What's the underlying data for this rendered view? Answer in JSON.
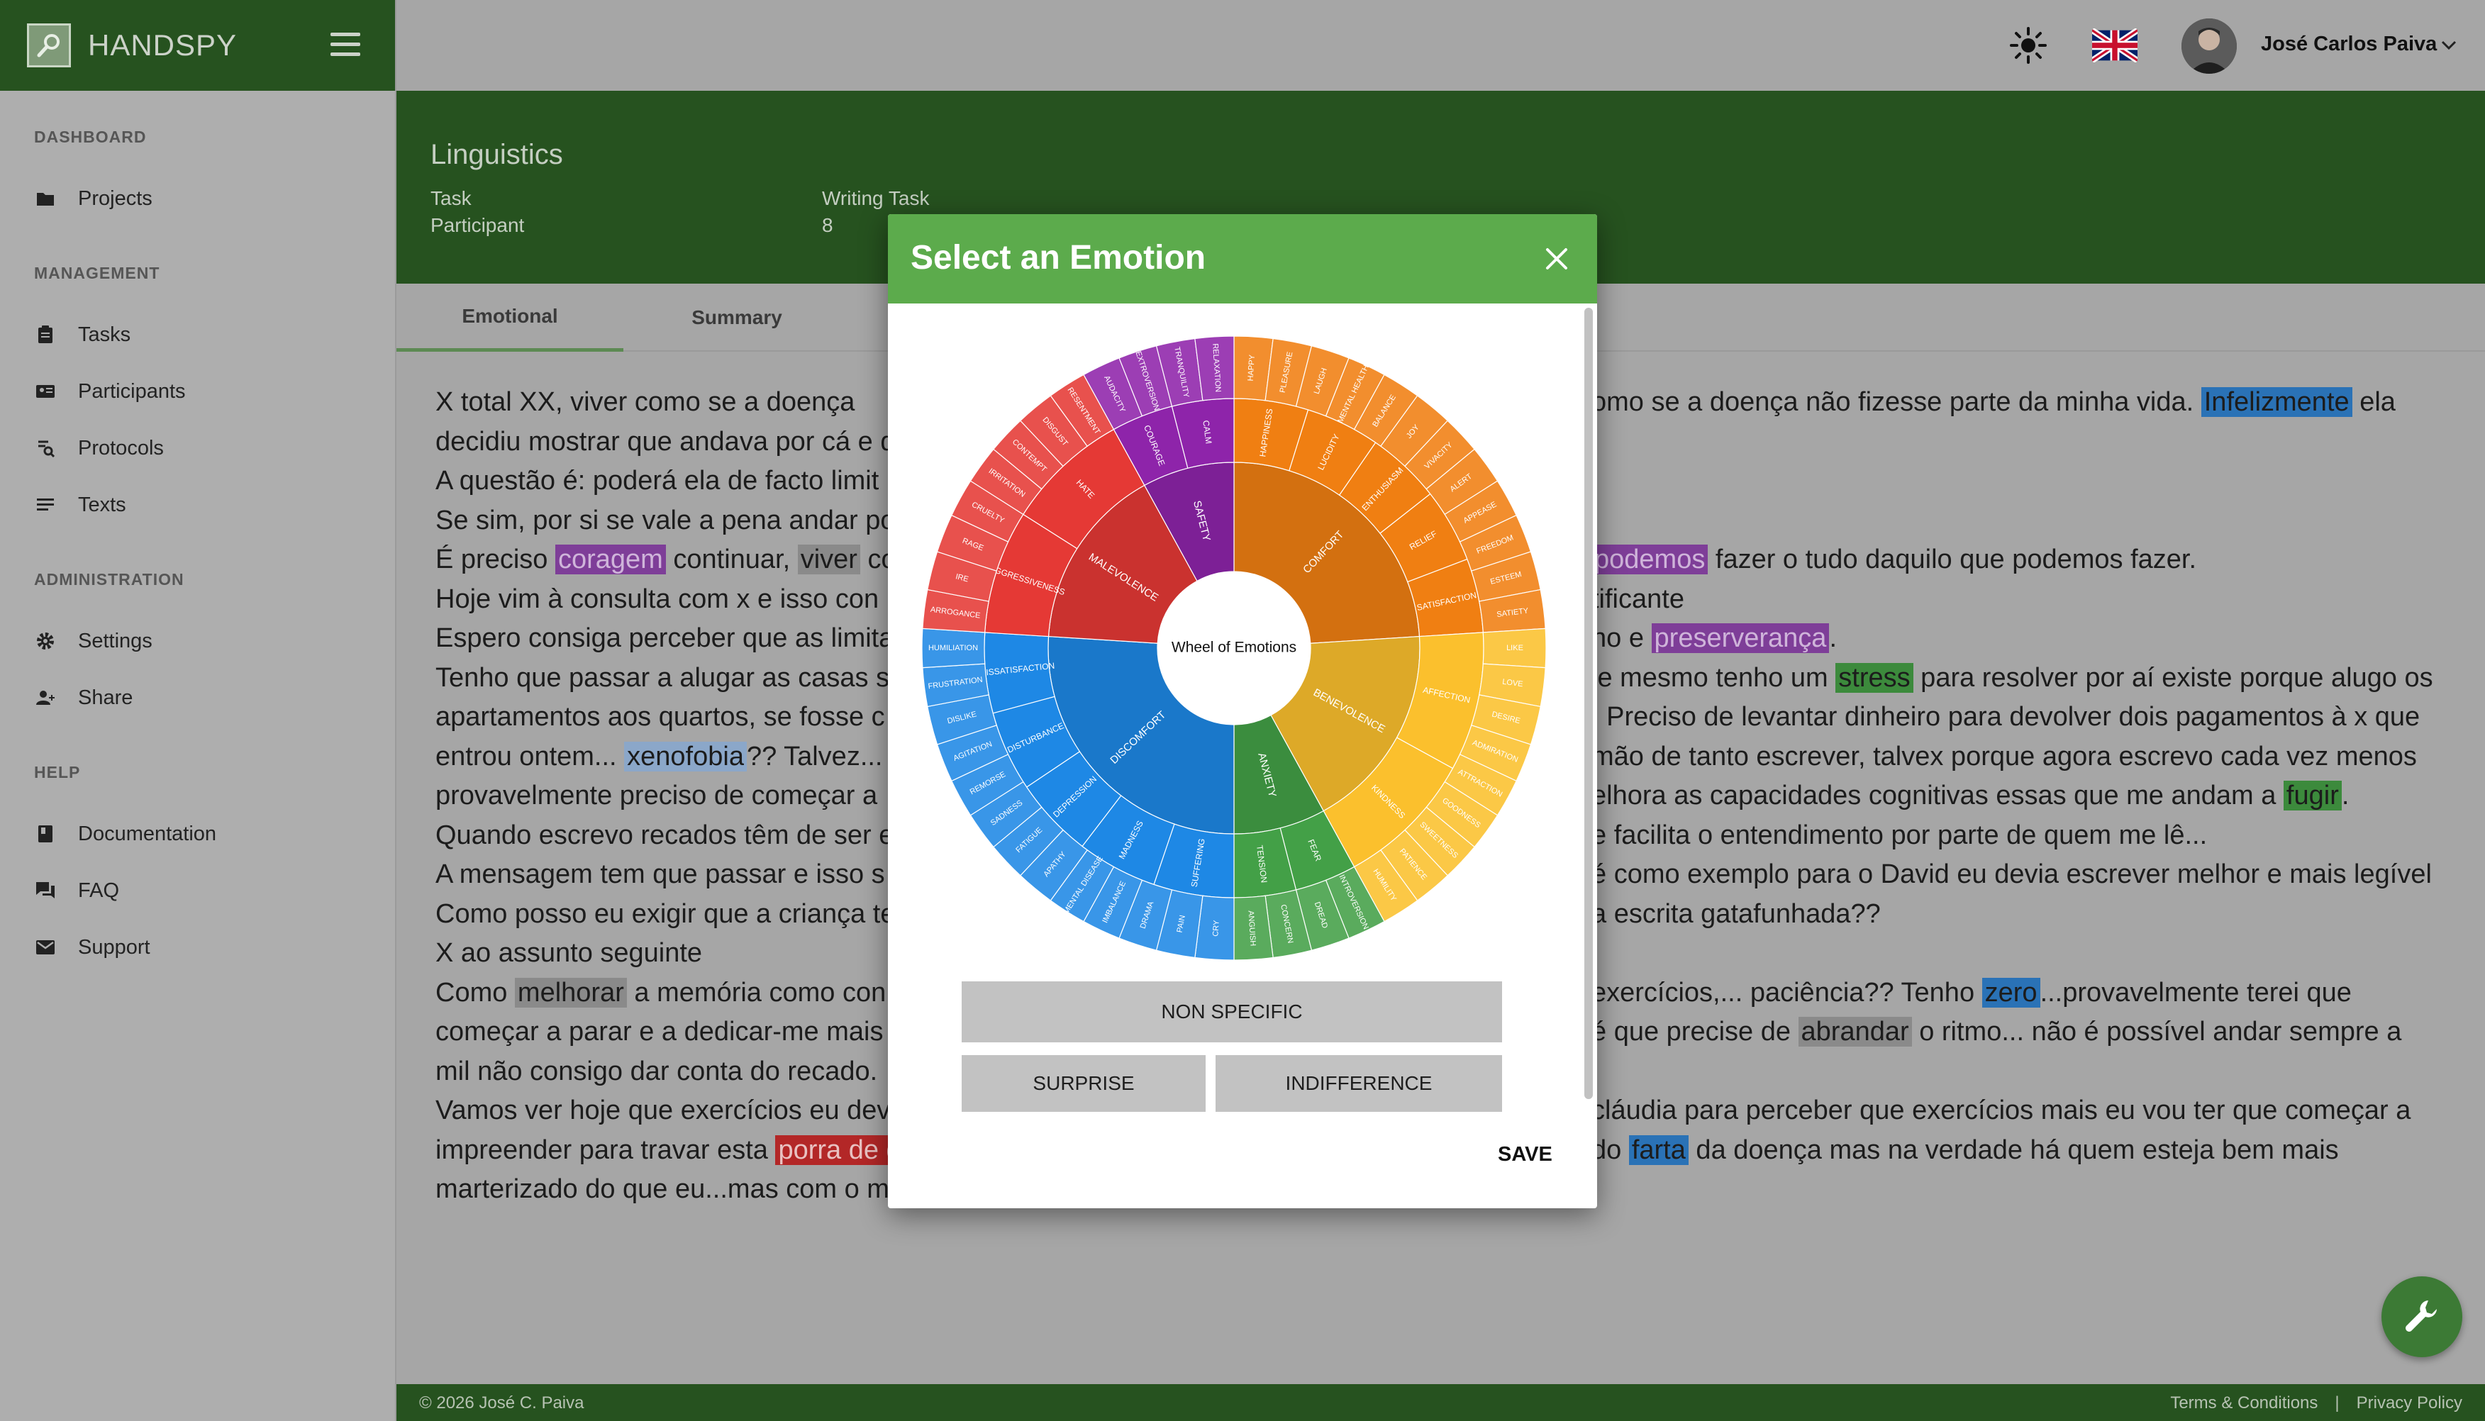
{
  "app": {
    "name": "HANDSPY"
  },
  "sidebar": {
    "sections": [
      {
        "title": "DASHBOARD",
        "items": [
          {
            "label": "Projects",
            "icon": "folder-icon"
          }
        ]
      },
      {
        "title": "MANAGEMENT",
        "items": [
          {
            "label": "Tasks",
            "icon": "clipboard-icon"
          },
          {
            "label": "Participants",
            "icon": "id-card-icon"
          },
          {
            "label": "Protocols",
            "icon": "protocol-icon"
          },
          {
            "label": "Texts",
            "icon": "text-lines-icon"
          }
        ]
      },
      {
        "title": "ADMINISTRATION",
        "items": [
          {
            "label": "Settings",
            "icon": "gear-icon"
          },
          {
            "label": "Share",
            "icon": "share-users-icon"
          }
        ]
      },
      {
        "title": "HELP",
        "items": [
          {
            "label": "Documentation",
            "icon": "book-icon"
          },
          {
            "label": "FAQ",
            "icon": "chat-icon"
          },
          {
            "label": "Support",
            "icon": "mail-icon"
          }
        ]
      }
    ]
  },
  "topbar": {
    "user_name": "José Carlos Paiva"
  },
  "project": {
    "title": "Linguistics",
    "task_label": "Task",
    "task_value": "Writing Task",
    "participant_label": "Participant",
    "participant_value": "8"
  },
  "tabs": [
    "Emotional",
    "Summary"
  ],
  "text_lines": [
    [
      {
        "t": "   X total XX, viver como se a doença"
      },
      {
        "t": "omo se a doença não fizesse parte da minha vida. ",
        "gap": true
      },
      {
        "t": "Infelizmente",
        "c": "hl-blue"
      },
      {
        "t": " ela"
      }
    ],
    [
      {
        "t": "decidiu mostrar que andava por cá e d"
      }
    ],
    [
      {
        "t": "A questão é: poderá ela de facto limit"
      }
    ],
    [
      {
        "t": "Se sim, por si se vale a pena andar po"
      }
    ],
    [
      {
        "t": "É preciso "
      },
      {
        "t": "coragem",
        "c": "hl-purple"
      },
      {
        "t": " continuar, "
      },
      {
        "t": "viver",
        "c": "hl-gray"
      },
      {
        "t": " co"
      },
      {
        "t": "podemos",
        "c": "hl-purple",
        "gap": true
      },
      {
        "t": " fazer o tudo daquilo que podemos fazer."
      }
    ],
    [
      {
        "t": "Hoje vim à consulta com x e isso con"
      },
      {
        "t": "tificante",
        "gap": true
      }
    ],
    [
      {
        "t": "Espero consiga perceber que as limita"
      },
      {
        "t": "ho e ",
        "gap": true
      },
      {
        "t": "preserverança",
        "c": "hl-purple"
      },
      {
        "t": "."
      }
    ],
    [
      {
        "t": "Tenho que passar a alugar as casas s"
      },
      {
        "t": "je mesmo tenho um ",
        "gap": true
      },
      {
        "t": "stress",
        "c": "hl-green"
      },
      {
        "t": " para resolver por aí existe porque alugo os"
      }
    ],
    [
      {
        "t": "apartamentos aos quartos, se fosse c"
      },
      {
        "t": ". Preciso de levantar dinheiro para devolver dois pagamentos à x que",
        "gap": true
      }
    ],
    [
      {
        "t": "entrou ontem... "
      },
      {
        "t": "xenofobia",
        "c": "hl-lightblue"
      },
      {
        "t": "?? Talvez..."
      },
      {
        "t": "mão de tanto escrever, talvex porque agora escrevo cada vez menos",
        "gap": true
      }
    ],
    [
      {
        "t": "provavelmente preciso de começar a "
      },
      {
        "t": "elhora as capacidades cognitivas essas que me andam a ",
        "gap": true
      },
      {
        "t": "fugir",
        "c": "hl-green"
      },
      {
        "t": "."
      }
    ],
    [
      {
        "t": "Quando escrevo recados têm de ser e"
      },
      {
        "t": "e facilita o entendimento por parte de quem me lê...",
        "gap": true
      }
    ],
    [
      {
        "t": "A mensagem tem que passar e isso s"
      },
      {
        "t": "é como exemplo para o David eu devia escrever melhor e mais legível",
        "gap": true
      }
    ],
    [
      {
        "t": "Como posso eu exigir que a criança te"
      },
      {
        "t": "a escrita gatafunhada??",
        "gap": true
      }
    ],
    [
      {
        "t": "X ao assunto seguinte"
      }
    ],
    [
      {
        "t": "Como "
      },
      {
        "t": "melhorar",
        "c": "hl-gray"
      },
      {
        "t": " a memória como con"
      },
      {
        "t": "exercícios,... paciência?? Tenho ",
        "gap": true
      },
      {
        "t": "zero",
        "c": "hl-blue"
      },
      {
        "t": "...provavelmente terei que"
      }
    ],
    [
      {
        "t": "começar a parar e a dedicar-me mais"
      },
      {
        "t": " é que precise de ",
        "gap": true
      },
      {
        "t": "abrandar",
        "c": "hl-gray"
      },
      {
        "t": " o ritmo... não é possível andar sempre a"
      }
    ],
    [
      {
        "t": "mil não consigo dar conta do recado."
      }
    ],
    [
      {
        "t": "Vamos ver hoje que exercícios eu dev"
      },
      {
        "t": "cláudia para perceber que exercícios mais eu vou ter que começar a",
        "gap": true
      }
    ],
    [
      {
        "t": "impreender para travar esta "
      },
      {
        "t": "porra de d",
        "c": "hl-red"
      },
      {
        "t": "do ",
        "gap": true
      },
      {
        "t": "farta",
        "c": "hl-blue"
      },
      {
        "t": " da doença mas na verdade há quem esteja bem mais"
      }
    ],
    [
      {
        "t": "marterizado do que eu...mas com o m"
      }
    ]
  ],
  "modal": {
    "title": "Select an Emotion",
    "wheel_center_label": "Wheel of Emotions",
    "buttons": {
      "non_specific": "NON SPECIFIC",
      "surprise": "SURPRISE",
      "indifference": "INDIFFERENCE"
    },
    "save_label": "SAVE"
  },
  "wheel": {
    "groups": [
      {
        "color": "#f07f12",
        "inner": [
          "COMFORT"
        ],
        "middle": [
          "HAPPINESS",
          "LUCIDITY",
          "ENTHUSIASM",
          "RELIEF",
          "SATISFACTION"
        ],
        "outer": [
          "HAPPY",
          "PLEASURE",
          "LAUGH",
          "MENTAL HEALTH",
          "BALANCE",
          "JOY",
          "VIVACITY",
          "ALERT",
          "APPEASE",
          "FREEDOM",
          "ESTEEM",
          "SATIETY"
        ]
      },
      {
        "color": "#fbc02d",
        "inner": [
          "BENEVOLENCE"
        ],
        "middle": [
          "AFFECTION",
          "KINDNESS"
        ],
        "outer": [
          "LIKE",
          "LOVE",
          "DESIRE",
          "ADMIRATION",
          "ATTRACTION",
          "GOODNESS",
          "SWEETNESS",
          "PATIENCE",
          "HUMILITY"
        ]
      },
      {
        "color": "#43a047",
        "inner": [
          "ANXIETY"
        ],
        "middle": [
          "FEAR",
          "TENSION"
        ],
        "outer": [
          "INTROVERSION",
          "DREAD",
          "CONCERN",
          "ANGUISH"
        ]
      },
      {
        "color": "#1e88e5",
        "inner": [
          "DISCOMFORT"
        ],
        "middle": [
          "SUFFERING",
          "MADNESS",
          "DEPRESSION",
          "DISTURBANCE",
          "DISSATISFACTION"
        ],
        "outer": [
          "CRY",
          "PAIN",
          "DRAMA",
          "IMBALANCE",
          "MENTAL DISEASE",
          "APATHY",
          "FATIGUE",
          "SADNESS",
          "REMORSE",
          "AGITATION",
          "DISLIKE",
          "FRUSTRATION",
          "HUMILIATION"
        ]
      },
      {
        "color": "#e53935",
        "inner": [
          "MALEVOLENCE"
        ],
        "middle": [
          "AGGRESSIVENESS",
          "HATE"
        ],
        "outer": [
          "ARROGANCE",
          "IRE",
          "RAGE",
          "CRUELTY",
          "IRRITATION",
          "CONTEMPT",
          "DISGUST",
          "RESENTMENT"
        ]
      },
      {
        "color": "#8e24aa",
        "inner": [
          "SAFETY"
        ],
        "middle": [
          "COURAGE",
          "CALM"
        ],
        "outer": [
          "AUDACITY",
          "EXTROVERSION",
          "TRANQUILITY",
          "RELAXATION"
        ]
      }
    ]
  },
  "footer": {
    "copyright": "© 2026 José C. Paiva",
    "terms": "Terms & Conditions",
    "separator": "|",
    "privacy": "Privacy Policy"
  }
}
